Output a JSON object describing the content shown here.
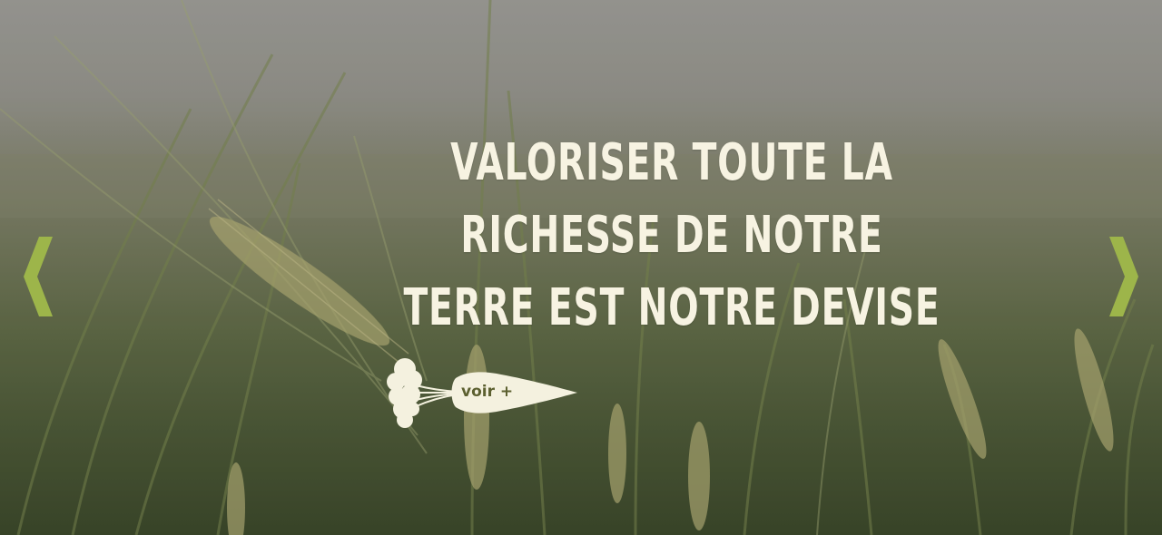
{
  "hero": {
    "headline": "Valoriser toute la richesse de notre terre est notre devise",
    "cta_label": "voir +"
  },
  "icons": {
    "prev": "chevron-left-icon",
    "next": "chevron-right-icon",
    "cta": "carrot-icon"
  },
  "colors": {
    "accent": "#9db54a",
    "headline_text": "#f7f3e2",
    "cta_fill": "#f4f1df",
    "cta_text": "#5c6030"
  }
}
